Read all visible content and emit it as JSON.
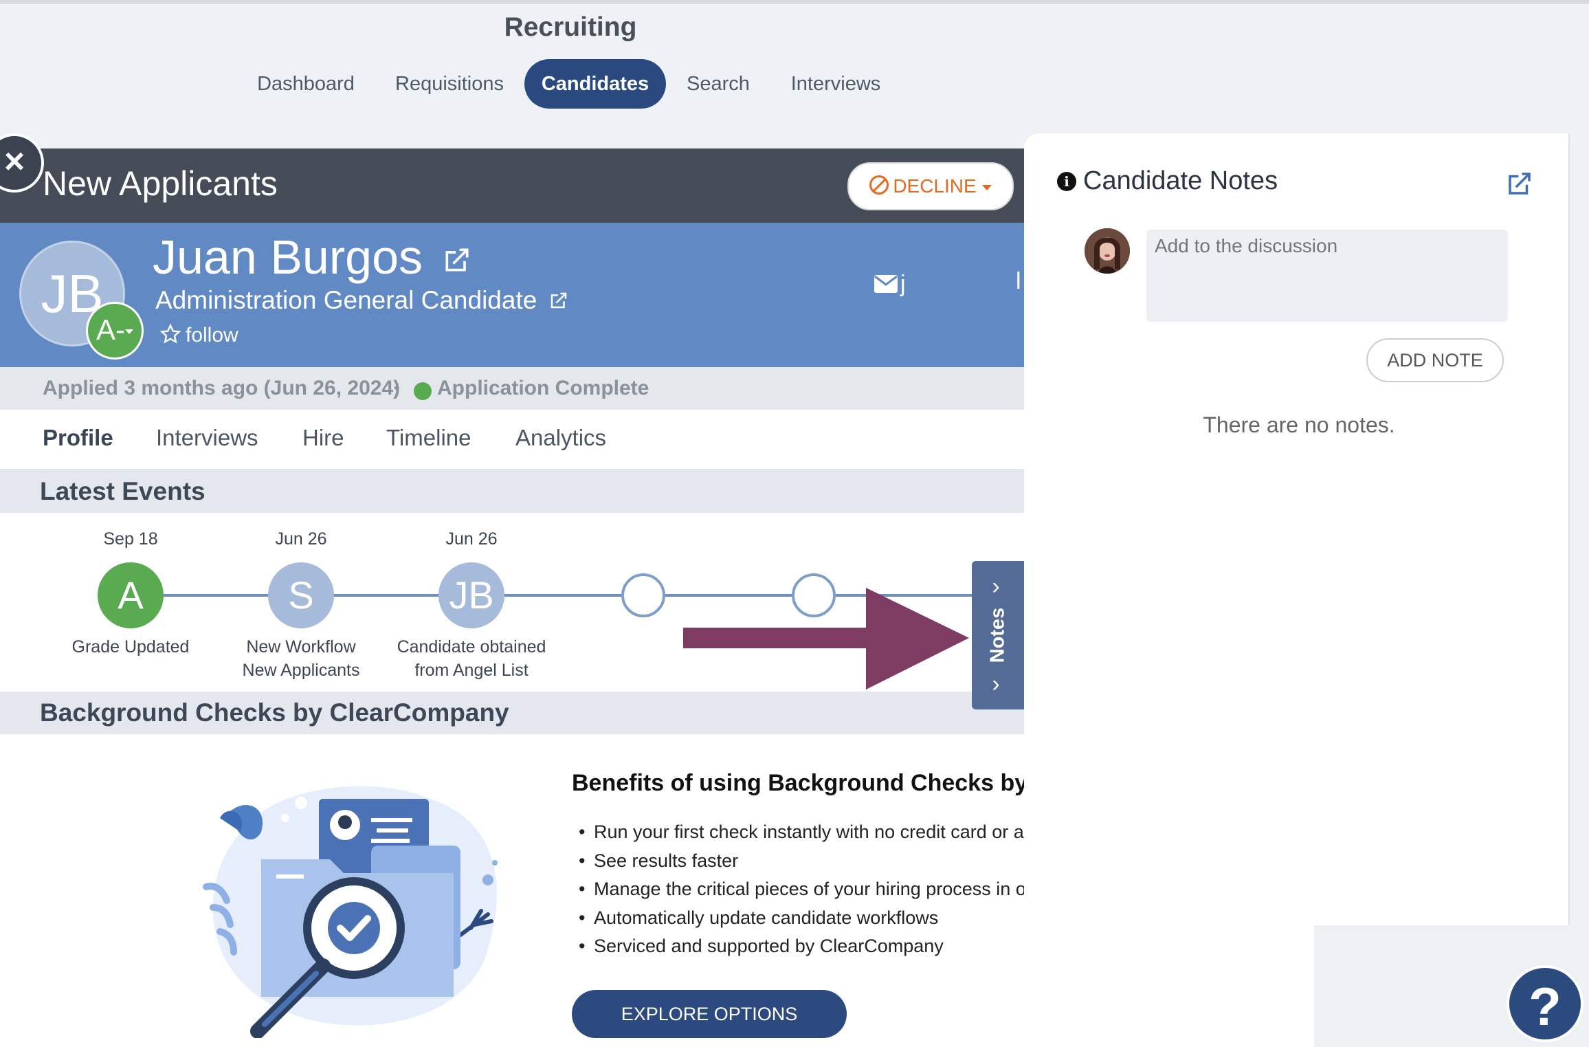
{
  "app": {
    "title": "Recruiting"
  },
  "nav": {
    "items": [
      {
        "label": "Dashboard"
      },
      {
        "label": "Requisitions"
      },
      {
        "label": "Candidates",
        "active": true
      },
      {
        "label": "Search"
      },
      {
        "label": "Interviews"
      }
    ]
  },
  "stage": {
    "title": "New Applicants",
    "decline_label": "DECLINE"
  },
  "candidate": {
    "initials": "JB",
    "grade": "A-",
    "name": "Juan Burgos",
    "role": "Administration General Candidate",
    "follow_label": "follow",
    "email_partial": "j",
    "phone_partial": "l"
  },
  "application": {
    "applied": "Applied 3 months ago (Jun 26, 2024)",
    "separator": "·",
    "status": "Application Complete"
  },
  "tabs": [
    {
      "label": "Profile",
      "active": true
    },
    {
      "label": "Interviews"
    },
    {
      "label": "Hire"
    },
    {
      "label": "Timeline"
    },
    {
      "label": "Analytics"
    }
  ],
  "latest_events": {
    "title": "Latest Events",
    "events": [
      {
        "date": "Sep 18",
        "initial": "A",
        "label_line1": "Grade Updated",
        "label_line2": ""
      },
      {
        "date": "Jun 26",
        "initial": "S",
        "label_line1": "New Workflow",
        "label_line2": "New Applicants"
      },
      {
        "date": "Jun 26",
        "initial": "JB",
        "label_line1": "Candidate obtained",
        "label_line2": "from Angel List"
      }
    ]
  },
  "notes_tab": {
    "label": "Notes"
  },
  "background_checks": {
    "title": "Background Checks by ClearCompany",
    "benefits_title": "Benefits of using Background Checks by C",
    "benefits": [
      "Run your first check instantly with no credit card or ar",
      "See results faster",
      "Manage the critical pieces of your hiring process in o",
      "Automatically update candidate workflows",
      "Serviced and supported by ClearCompany"
    ],
    "cta_label": "EXPLORE OPTIONS"
  },
  "notes_panel": {
    "title": "Candidate Notes",
    "input_placeholder": "Add to the discussion",
    "add_button": "ADD NOTE",
    "empty_text": "There are no notes."
  },
  "help": {
    "label": "?"
  },
  "colors": {
    "brand_navy": "#2a4a7f",
    "banner_blue": "#6189c3",
    "grade_green": "#5aaa52",
    "decline_orange": "#e56a1f",
    "annotation_arrow": "#7e3c63"
  }
}
